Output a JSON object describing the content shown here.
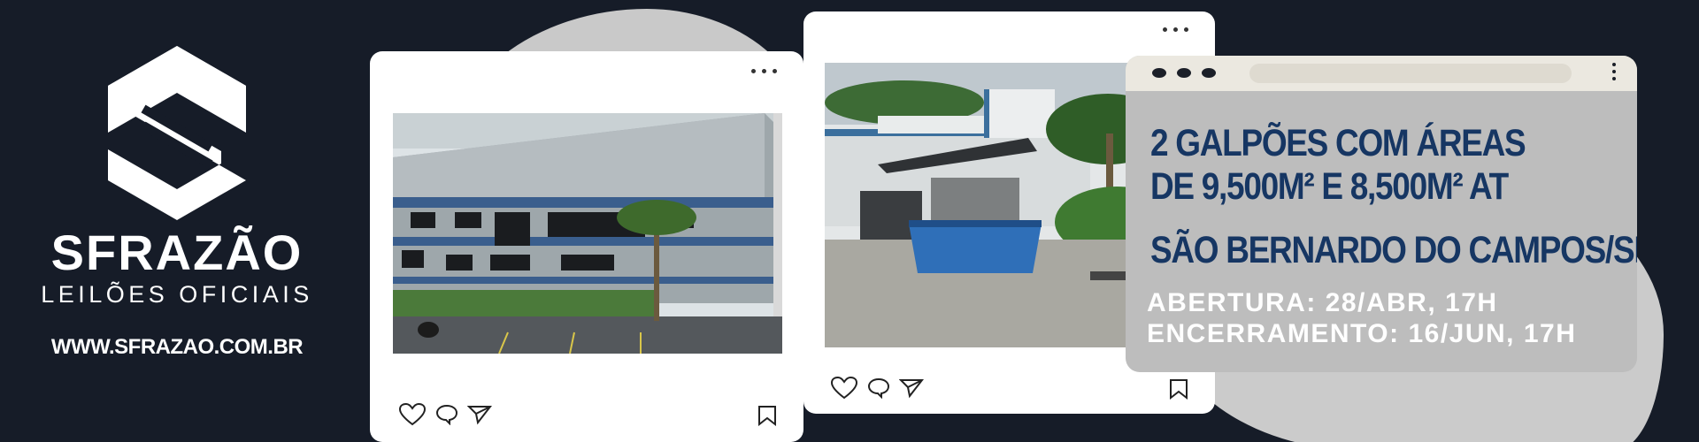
{
  "brand": {
    "name": "SFRAZÃO",
    "subtitle": "LEILÕES OFICIAIS",
    "url": "WWW.SFRAZAO.COM.BR"
  },
  "posts": [
    {
      "icons": [
        "heart-icon",
        "comment-icon",
        "send-icon",
        "bookmark-icon",
        "more-dots-icon"
      ]
    },
    {
      "icons": [
        "heart-icon",
        "comment-icon",
        "send-icon",
        "bookmark-icon",
        "more-dots-icon"
      ]
    }
  ],
  "listing": {
    "headline_line1": "2 GALPÕES COM ÁREAS",
    "headline_line2": "DE 9,500M² E 8,500M² AT",
    "location": "SÃO BERNARDO DO CAMPOS/SP",
    "opening": "ABERTURA: 28/ABR, 17H",
    "closing": "ENCERRAMENTO: 16/JUN, 17H"
  },
  "colors": {
    "background": "#161c28",
    "headline": "#163663",
    "panel": "#bdbdbd",
    "blob": "#c9c9c9"
  }
}
